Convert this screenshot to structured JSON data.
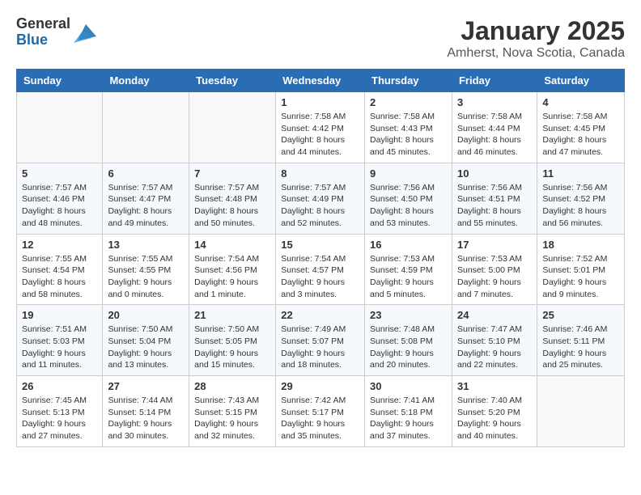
{
  "header": {
    "logo_general": "General",
    "logo_blue": "Blue",
    "title": "January 2025",
    "subtitle": "Amherst, Nova Scotia, Canada"
  },
  "weekdays": [
    "Sunday",
    "Monday",
    "Tuesday",
    "Wednesday",
    "Thursday",
    "Friday",
    "Saturday"
  ],
  "weeks": [
    [
      {
        "day": "",
        "info": ""
      },
      {
        "day": "",
        "info": ""
      },
      {
        "day": "",
        "info": ""
      },
      {
        "day": "1",
        "info": "Sunrise: 7:58 AM\nSunset: 4:42 PM\nDaylight: 8 hours and 44 minutes."
      },
      {
        "day": "2",
        "info": "Sunrise: 7:58 AM\nSunset: 4:43 PM\nDaylight: 8 hours and 45 minutes."
      },
      {
        "day": "3",
        "info": "Sunrise: 7:58 AM\nSunset: 4:44 PM\nDaylight: 8 hours and 46 minutes."
      },
      {
        "day": "4",
        "info": "Sunrise: 7:58 AM\nSunset: 4:45 PM\nDaylight: 8 hours and 47 minutes."
      }
    ],
    [
      {
        "day": "5",
        "info": "Sunrise: 7:57 AM\nSunset: 4:46 PM\nDaylight: 8 hours and 48 minutes."
      },
      {
        "day": "6",
        "info": "Sunrise: 7:57 AM\nSunset: 4:47 PM\nDaylight: 8 hours and 49 minutes."
      },
      {
        "day": "7",
        "info": "Sunrise: 7:57 AM\nSunset: 4:48 PM\nDaylight: 8 hours and 50 minutes."
      },
      {
        "day": "8",
        "info": "Sunrise: 7:57 AM\nSunset: 4:49 PM\nDaylight: 8 hours and 52 minutes."
      },
      {
        "day": "9",
        "info": "Sunrise: 7:56 AM\nSunset: 4:50 PM\nDaylight: 8 hours and 53 minutes."
      },
      {
        "day": "10",
        "info": "Sunrise: 7:56 AM\nSunset: 4:51 PM\nDaylight: 8 hours and 55 minutes."
      },
      {
        "day": "11",
        "info": "Sunrise: 7:56 AM\nSunset: 4:52 PM\nDaylight: 8 hours and 56 minutes."
      }
    ],
    [
      {
        "day": "12",
        "info": "Sunrise: 7:55 AM\nSunset: 4:54 PM\nDaylight: 8 hours and 58 minutes."
      },
      {
        "day": "13",
        "info": "Sunrise: 7:55 AM\nSunset: 4:55 PM\nDaylight: 9 hours and 0 minutes."
      },
      {
        "day": "14",
        "info": "Sunrise: 7:54 AM\nSunset: 4:56 PM\nDaylight: 9 hours and 1 minute."
      },
      {
        "day": "15",
        "info": "Sunrise: 7:54 AM\nSunset: 4:57 PM\nDaylight: 9 hours and 3 minutes."
      },
      {
        "day": "16",
        "info": "Sunrise: 7:53 AM\nSunset: 4:59 PM\nDaylight: 9 hours and 5 minutes."
      },
      {
        "day": "17",
        "info": "Sunrise: 7:53 AM\nSunset: 5:00 PM\nDaylight: 9 hours and 7 minutes."
      },
      {
        "day": "18",
        "info": "Sunrise: 7:52 AM\nSunset: 5:01 PM\nDaylight: 9 hours and 9 minutes."
      }
    ],
    [
      {
        "day": "19",
        "info": "Sunrise: 7:51 AM\nSunset: 5:03 PM\nDaylight: 9 hours and 11 minutes."
      },
      {
        "day": "20",
        "info": "Sunrise: 7:50 AM\nSunset: 5:04 PM\nDaylight: 9 hours and 13 minutes."
      },
      {
        "day": "21",
        "info": "Sunrise: 7:50 AM\nSunset: 5:05 PM\nDaylight: 9 hours and 15 minutes."
      },
      {
        "day": "22",
        "info": "Sunrise: 7:49 AM\nSunset: 5:07 PM\nDaylight: 9 hours and 18 minutes."
      },
      {
        "day": "23",
        "info": "Sunrise: 7:48 AM\nSunset: 5:08 PM\nDaylight: 9 hours and 20 minutes."
      },
      {
        "day": "24",
        "info": "Sunrise: 7:47 AM\nSunset: 5:10 PM\nDaylight: 9 hours and 22 minutes."
      },
      {
        "day": "25",
        "info": "Sunrise: 7:46 AM\nSunset: 5:11 PM\nDaylight: 9 hours and 25 minutes."
      }
    ],
    [
      {
        "day": "26",
        "info": "Sunrise: 7:45 AM\nSunset: 5:13 PM\nDaylight: 9 hours and 27 minutes."
      },
      {
        "day": "27",
        "info": "Sunrise: 7:44 AM\nSunset: 5:14 PM\nDaylight: 9 hours and 30 minutes."
      },
      {
        "day": "28",
        "info": "Sunrise: 7:43 AM\nSunset: 5:15 PM\nDaylight: 9 hours and 32 minutes."
      },
      {
        "day": "29",
        "info": "Sunrise: 7:42 AM\nSunset: 5:17 PM\nDaylight: 9 hours and 35 minutes."
      },
      {
        "day": "30",
        "info": "Sunrise: 7:41 AM\nSunset: 5:18 PM\nDaylight: 9 hours and 37 minutes."
      },
      {
        "day": "31",
        "info": "Sunrise: 7:40 AM\nSunset: 5:20 PM\nDaylight: 9 hours and 40 minutes."
      },
      {
        "day": "",
        "info": ""
      }
    ]
  ]
}
